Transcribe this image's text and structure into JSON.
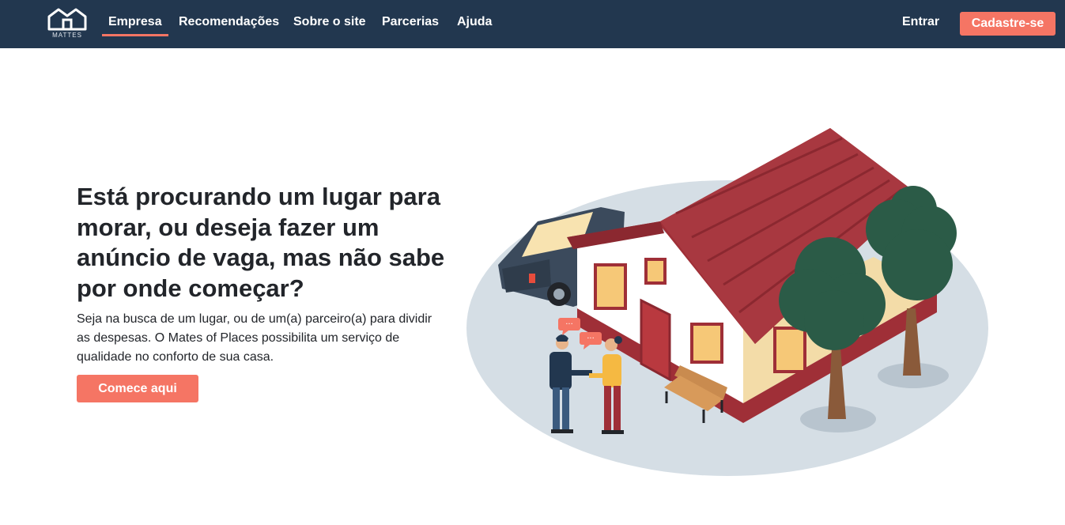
{
  "brand": {
    "logo_text": "MATTES"
  },
  "nav": {
    "items": [
      {
        "label": "Empresa",
        "active": true
      },
      {
        "label": "Recomendações",
        "active": false
      },
      {
        "label": "Sobre o site",
        "active": false
      },
      {
        "label": "Parcerias",
        "active": false
      },
      {
        "label": "Ajuda",
        "active": false
      }
    ],
    "login_label": "Entrar",
    "signup_label": "Cadastre-se"
  },
  "hero": {
    "title": "Está procurando um lugar para morar, ou deseja fazer um anúncio de vaga, mas não sabe por onde começar?",
    "description": "Seja na busca de um lugar, ou de um(a) parceiro(a) para dividir as despesas. O Mates of Places possibilita um serviço de qualidade no conforto de sua casa.",
    "cta_label": "Comece aqui",
    "chat_bubble_1": "···",
    "chat_bubble_2": "···"
  },
  "colors": {
    "navbar": "#22374f",
    "accent": "#f57564",
    "text": "#22252a",
    "roof": "#9f2f37",
    "wall": "#ffffff",
    "tree": "#2b5b47"
  }
}
